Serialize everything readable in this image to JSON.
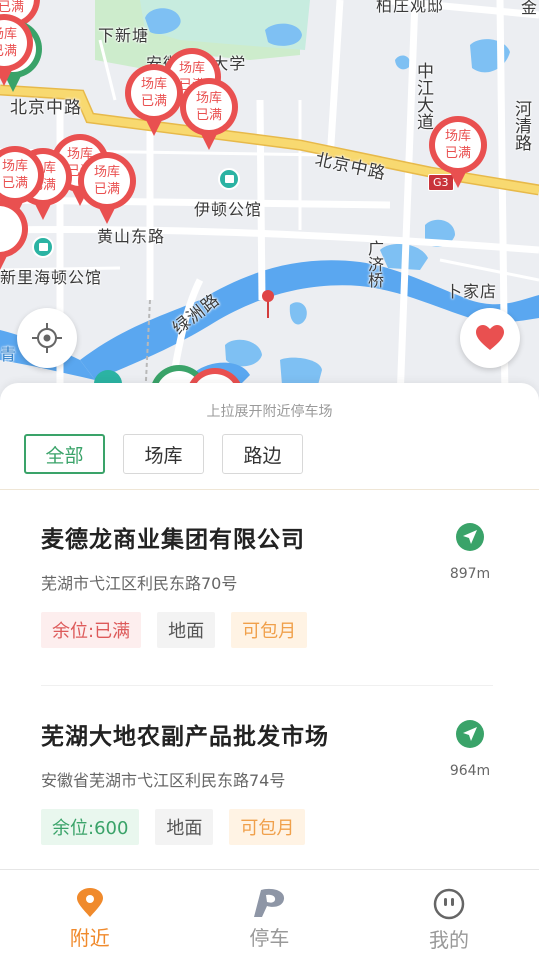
{
  "map": {
    "labels": {
      "xinxintang": "下新塘",
      "univ": "安徽■■大学",
      "beijing_road_w": "北京中路",
      "beijing_road_e": "北京中路",
      "zhongjiang": "中江大道",
      "heqing": "河清路",
      "baizhuang": "柏庄观邸",
      "jin": "金",
      "yidun": "伊顿公馆",
      "huangshan": "黄山东路",
      "haidun": "新里海顿公馆",
      "luzhou": "绿洲路",
      "guangji": "广济桥",
      "bujia": "卜家店",
      "qing": "青"
    },
    "highway_badge": "G3",
    "pin_text": [
      "场库",
      "已满"
    ]
  },
  "sheet": {
    "pull_hint": "上拉展开附近停车场",
    "filters": [
      {
        "label": "全部",
        "active": true
      },
      {
        "label": "场库",
        "active": false
      },
      {
        "label": "路边",
        "active": false
      }
    ]
  },
  "parkings": [
    {
      "name": "麦德龙商业集团有限公司",
      "address": "芜湖市弋江区利民东路70号",
      "distance": "897m",
      "tags": {
        "spaces": "余位:已满",
        "type": "地面",
        "monthly": "可包月"
      }
    },
    {
      "name": "芜湖大地农副产品批发市场",
      "address": "安徽省芜湖市弋江区利民东路74号",
      "distance": "964m",
      "tags": {
        "spaces": "余位:600",
        "type": "地面",
        "monthly": "可包月"
      }
    }
  ],
  "tabbar": {
    "tabs": [
      {
        "label": "附近",
        "active": true
      },
      {
        "label": "停车",
        "active": false
      },
      {
        "label": "我的",
        "active": false
      }
    ]
  },
  "colors": {
    "accent_green": "#3aa369",
    "pin_red": "#e95050",
    "tab_active_orange": "#f08a2c",
    "road_yellow": "#f5d66b",
    "water_blue": "#5aa7f0"
  }
}
